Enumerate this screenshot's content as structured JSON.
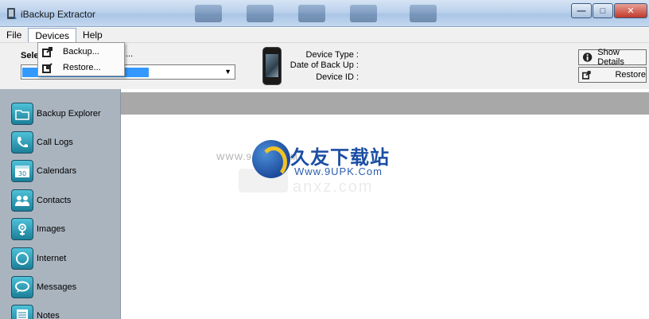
{
  "window": {
    "title": "iBackup Extractor",
    "controls": [
      "minimize",
      "maximize",
      "close"
    ]
  },
  "menu": {
    "items": [
      {
        "label": "File"
      },
      {
        "label": "Devices"
      },
      {
        "label": "Help"
      }
    ],
    "devices_dropdown": [
      {
        "label": "Backup...",
        "icon": "backup-icon"
      },
      {
        "label": "Restore...",
        "icon": "restore-icon"
      }
    ]
  },
  "toolbar": {
    "select_label_visible": "Sele",
    "select_label_tail": "...",
    "device_combo_value": "",
    "device_info": {
      "type_label": "Device Type :",
      "backup_date_label": "Date of Back Up :",
      "id_label": "Device ID :"
    },
    "show_details_label": "Show Details",
    "restore_label": "Restore"
  },
  "sidebar": {
    "items": [
      {
        "label": "Backup Explorer",
        "icon": "folder-icon"
      },
      {
        "label": "Call Logs",
        "icon": "phone-icon"
      },
      {
        "label": "Calendars",
        "icon": "calendar-icon"
      },
      {
        "label": "Contacts",
        "icon": "contacts-icon"
      },
      {
        "label": "Images",
        "icon": "images-icon"
      },
      {
        "label": "Internet",
        "icon": "globe-icon"
      },
      {
        "label": "Messages",
        "icon": "message-icon"
      },
      {
        "label": "Notes",
        "icon": "notes-icon"
      }
    ]
  },
  "watermark": {
    "site_small": "WWW.9UPK.COM",
    "brand_cn": "久友下载站",
    "brand_url": "Www.9UPK.Com",
    "faint_text": "anxz.com"
  },
  "colors": {
    "selection": "#3399ff",
    "sidebar_bg": "#aab4bf",
    "band": "#a8a8a8",
    "icon_accent": "#2aa3c0"
  }
}
